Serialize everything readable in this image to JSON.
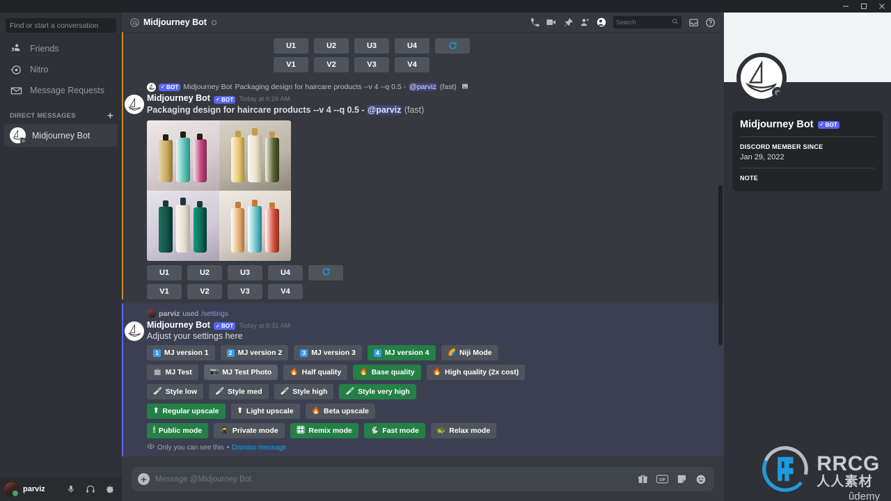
{
  "window": {
    "minimize": "—",
    "maximize": "□",
    "close": "✕"
  },
  "sidebar": {
    "search_placeholder": "Find or start a conversation",
    "nav": [
      {
        "label": "Friends",
        "icon": "friends-icon"
      },
      {
        "label": "Nitro",
        "icon": "nitro-icon"
      },
      {
        "label": "Message Requests",
        "icon": "envelope-icon"
      }
    ],
    "dm_header": "DIRECT MESSAGES",
    "dm_add": "+",
    "dms": [
      {
        "label": "Midjourney Bot"
      }
    ]
  },
  "user_panel": {
    "name": "parviz"
  },
  "channel_header": {
    "at": "@",
    "title": "Midjourney Bot",
    "search_placeholder": "Search"
  },
  "messages": {
    "top_buttons": {
      "upscale": [
        "U1",
        "U2",
        "U3",
        "U4"
      ],
      "variation": [
        "V1",
        "V2",
        "V3",
        "V4"
      ],
      "refresh": "🔄"
    },
    "image_message": {
      "reply_author": "Midjourney Bot",
      "reply_bot_tag": "BOT",
      "reply_text": "Packaging design for haircare products --v 4 --q 0.5 - ",
      "reply_mention": "@parviz",
      "reply_suffix": " (fast)",
      "author": "Midjourney Bot",
      "bot_tag": "BOT",
      "timestamp": "Today at 6:26 AM",
      "prompt": "Packaging design for haircare products --v 4 --q 0.5 - ",
      "mention": "@parviz",
      "suffix": " (fast)",
      "upscale": [
        "U1",
        "U2",
        "U3",
        "U4"
      ],
      "variation": [
        "V1",
        "V2",
        "V3",
        "V4"
      ],
      "refresh": "🔄"
    },
    "settings_message": {
      "command_user": "parviz",
      "command_used": " used ",
      "command_name": "/settings",
      "author": "Midjourney Bot",
      "bot_tag": "BOT",
      "timestamp": "Today at 8:31 AM",
      "body": "Adjust your settings here",
      "rows": [
        [
          {
            "emoji": "1",
            "emoji_kind": "num",
            "label": "MJ version 1",
            "state": "off"
          },
          {
            "emoji": "2",
            "emoji_kind": "num",
            "label": "MJ version 2",
            "state": "off"
          },
          {
            "emoji": "3",
            "emoji_kind": "num",
            "label": "MJ version 3",
            "state": "off"
          },
          {
            "emoji": "4",
            "emoji_kind": "num",
            "label": "MJ version 4",
            "state": "on"
          },
          {
            "emoji": "🌈",
            "emoji_kind": "glyph",
            "label": "Niji Mode",
            "state": "off"
          }
        ],
        [
          {
            "emoji": "🤖",
            "emoji_kind": "glyph",
            "label": "MJ Test",
            "state": "off"
          },
          {
            "emoji": "📷",
            "emoji_kind": "glyph",
            "label": "MJ Test Photo",
            "state": "hover"
          },
          {
            "emoji": "🔥",
            "emoji_kind": "glyph",
            "label": "Half quality",
            "state": "off"
          },
          {
            "emoji": "🔥",
            "emoji_kind": "glyph",
            "label": "Base quality",
            "state": "on"
          },
          {
            "emoji": "🔥",
            "emoji_kind": "glyph",
            "label": "High quality (2x cost)",
            "state": "off"
          }
        ],
        [
          {
            "emoji": "🖌",
            "emoji_kind": "glyph",
            "label": "Style low",
            "state": "off"
          },
          {
            "emoji": "🖌",
            "emoji_kind": "glyph",
            "label": "Style med",
            "state": "off"
          },
          {
            "emoji": "🖌",
            "emoji_kind": "glyph",
            "label": "Style high",
            "state": "off"
          },
          {
            "emoji": "🖌",
            "emoji_kind": "glyph",
            "label": "Style very high",
            "state": "on"
          }
        ],
        [
          {
            "emoji": "⬆",
            "emoji_kind": "glyph",
            "label": "Regular upscale",
            "state": "on"
          },
          {
            "emoji": "⬆",
            "emoji_kind": "glyph",
            "label": "Light upscale",
            "state": "off"
          },
          {
            "emoji": "🔥",
            "emoji_kind": "glyph",
            "label": "Beta upscale",
            "state": "off"
          }
        ],
        [
          {
            "emoji": "🕯",
            "emoji_kind": "glyph",
            "label": "Public mode",
            "state": "on"
          },
          {
            "emoji": "🥷",
            "emoji_kind": "glyph",
            "label": "Private mode",
            "state": "off"
          },
          {
            "emoji": "🎛",
            "emoji_kind": "glyph",
            "label": "Remix mode",
            "state": "on"
          },
          {
            "emoji": "🐇",
            "emoji_kind": "glyph",
            "label": "Fast mode",
            "state": "on"
          },
          {
            "emoji": "🐢",
            "emoji_kind": "glyph",
            "label": "Relax mode",
            "state": "off"
          }
        ]
      ],
      "ephemeral_text": "Only you can see this",
      "ephemeral_sep": " • ",
      "ephemeral_link": "Dismiss message"
    }
  },
  "composer": {
    "placeholder": "Message @Midjourney Bot"
  },
  "profile": {
    "name": "Midjourney Bot",
    "bot_tag": "BOT",
    "member_since_label": "DISCORD MEMBER SINCE",
    "member_since_value": "Jan 29, 2022",
    "note_label": "NOTE"
  },
  "watermark": {
    "brand": "RRCG",
    "cn": "人人素材",
    "udemy": "ûdemy"
  },
  "colors": {
    "accent_blurple": "#5865f2",
    "success_green": "#248046",
    "reply_accent": "#c88a32",
    "link_blue": "#00a8fc"
  }
}
